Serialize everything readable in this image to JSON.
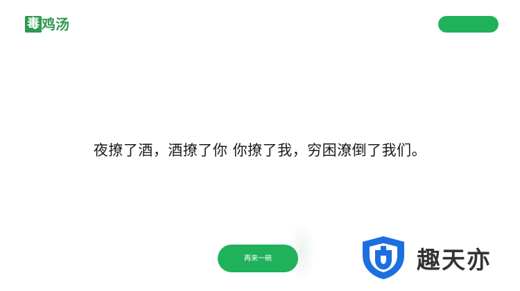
{
  "header": {
    "logo_mark": "毒",
    "logo_rest": "鸡汤"
  },
  "main": {
    "quote": "夜撩了酒，酒撩了你 你撩了我，穷困潦倒了我们。"
  },
  "actions": {
    "again_label": "再来一碗"
  },
  "watermark": {
    "text": "趣天亦"
  },
  "colors": {
    "brand_green": "#1fb25a",
    "logo_green": "#2e9a52",
    "shield_blue": "#1d6fe0"
  }
}
